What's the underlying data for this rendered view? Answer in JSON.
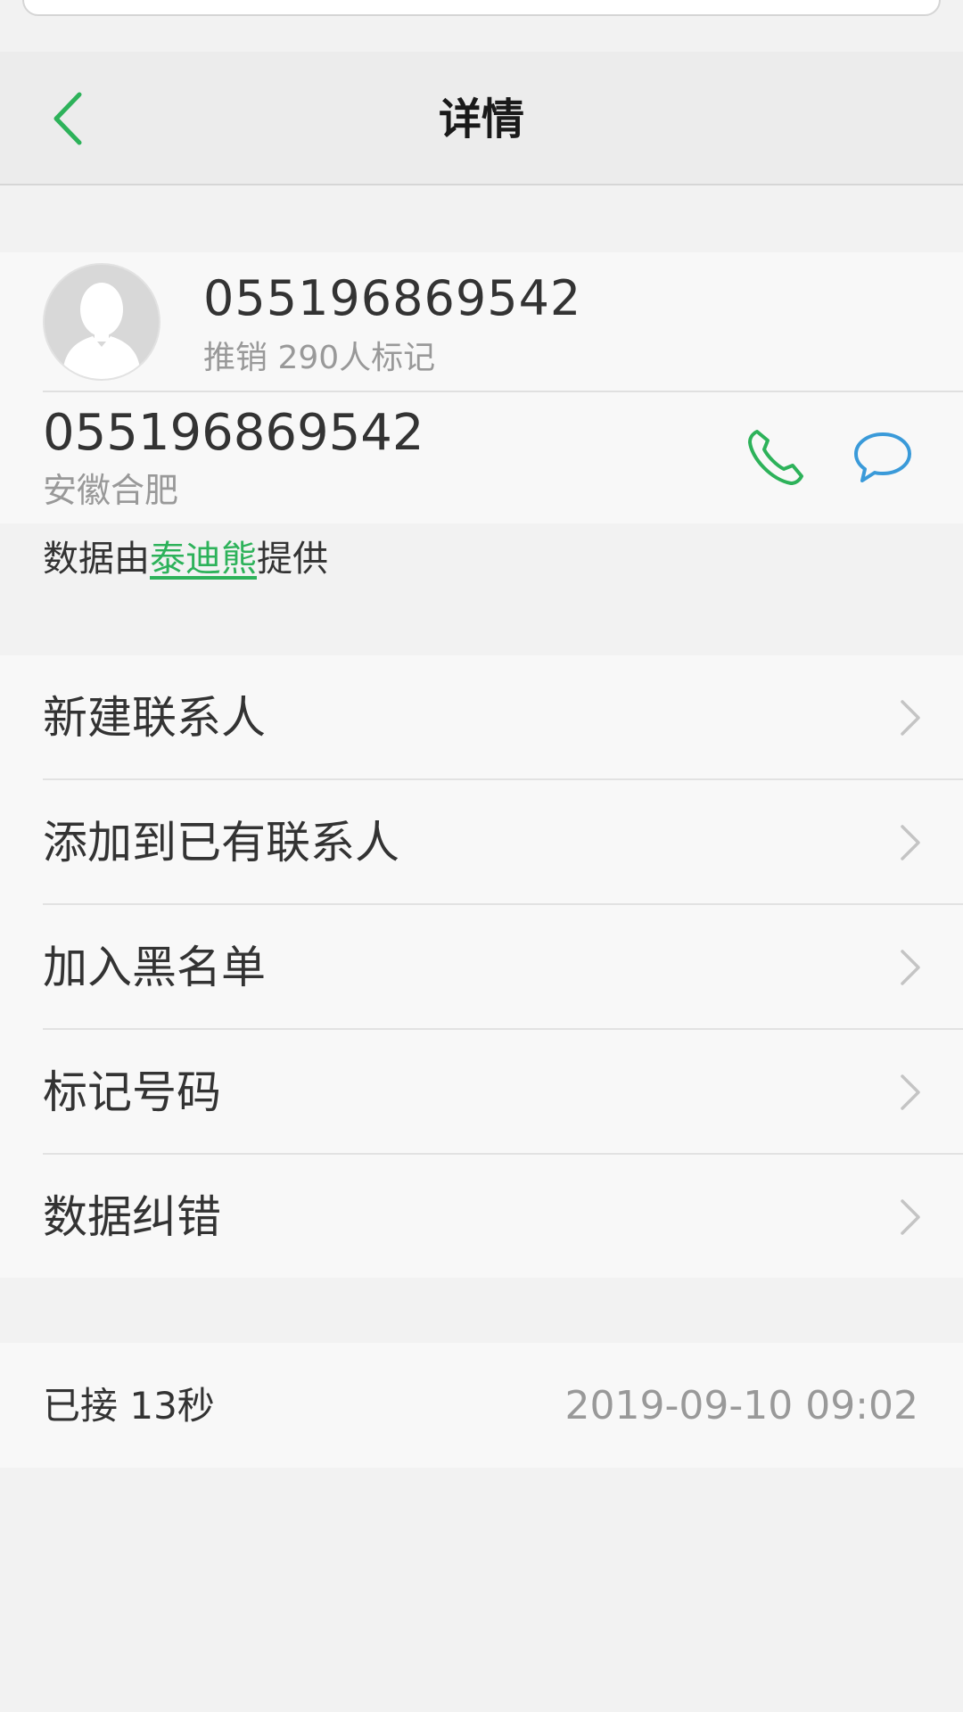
{
  "header": {
    "title": "详情"
  },
  "profile": {
    "caller_name": "055196869542",
    "tag_text": "推销 290人标记",
    "phone_number": "055196869542",
    "location": "安徽合肥"
  },
  "provider": {
    "prefix": "数据由",
    "link": "泰迪熊",
    "suffix": "提供"
  },
  "menu": {
    "items": [
      {
        "label": "新建联系人"
      },
      {
        "label": "添加到已有联系人"
      },
      {
        "label": "加入黑名单"
      },
      {
        "label": "标记号码"
      },
      {
        "label": "数据纠错"
      }
    ]
  },
  "call_log": {
    "status": "已接 13秒",
    "time": "2019-09-10 09:02"
  },
  "icons": {
    "back": "chevron-left-icon",
    "call": "phone-icon",
    "message": "message-bubble-icon",
    "menu_arrow": "chevron-right-icon",
    "avatar": "person-silhouette-icon"
  },
  "colors": {
    "accent_green": "#2db25a",
    "message_blue": "#3a9ad9",
    "secondary_text": "#999999",
    "primary_text": "#333333"
  }
}
